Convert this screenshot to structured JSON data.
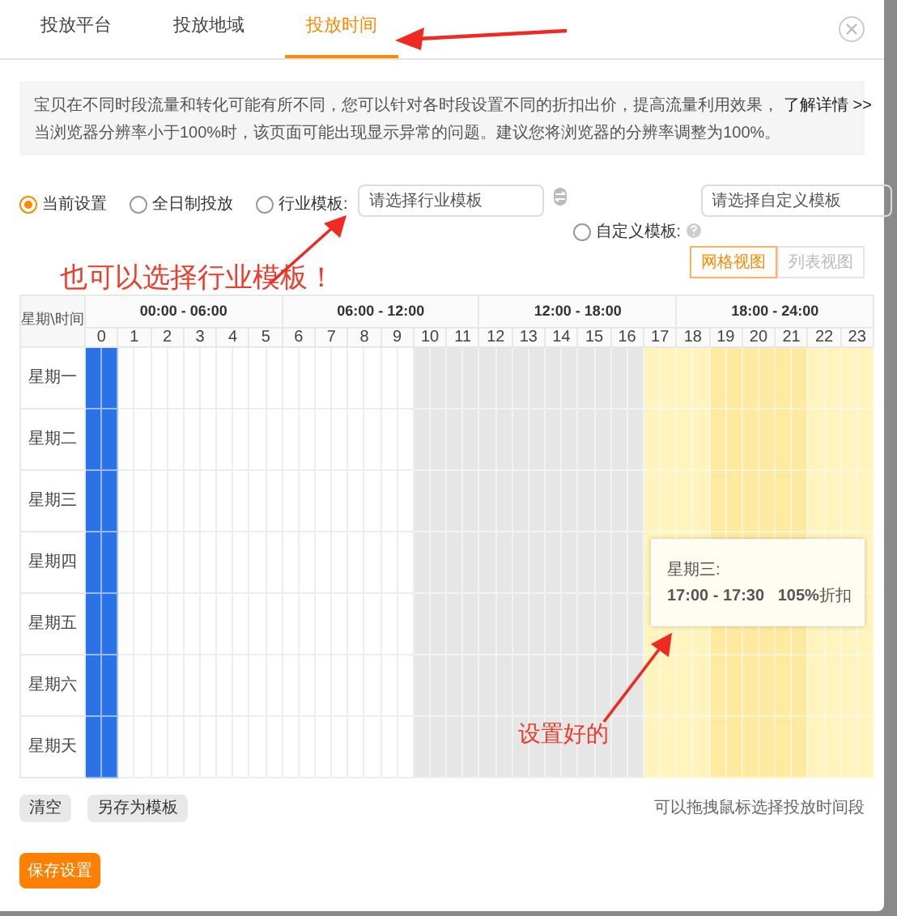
{
  "tabs": [
    {
      "label": "投放平台",
      "selected": false
    },
    {
      "label": "投放地域",
      "selected": false
    },
    {
      "label": "投放时间",
      "selected": true
    }
  ],
  "notice": {
    "lines": [
      "宝贝在不同时段流量和转化可能有所不同，您可以针对各时段设置不同的折扣出价，提高流量利用效果，",
      "当浏览器分辨率小于100%时，该页面可能出现显示异常的问题。建议您将浏览器的分辨率调整为100%。"
    ],
    "link": "了解详情 >>"
  },
  "template_options": [
    {
      "kind": "plain",
      "label": "当前设置",
      "selected": true
    },
    {
      "kind": "plain",
      "label": "全日制投放",
      "selected": false
    },
    {
      "kind": "industry",
      "label": "行业模板:",
      "selected": false,
      "placeholder": "请选择行业模板"
    },
    {
      "kind": "custom",
      "label": "自定义模板:",
      "selected": false,
      "placeholder": "请选择自定义模板"
    }
  ],
  "view_toggle": [
    {
      "label": "网格视图",
      "selected": true
    },
    {
      "label": "列表视图",
      "selected": false
    }
  ],
  "grid": {
    "corner": "星期\\时间",
    "groups": [
      "00:00 - 06:00",
      "06:00 - 12:00",
      "12:00 - 18:00",
      "18:00 - 24:00"
    ],
    "hours": [
      {
        "label": "0",
        "color": "#2b72e6"
      },
      {
        "label": "1",
        "color": "#ffffff"
      },
      {
        "label": "2",
        "color": "#ffffff"
      },
      {
        "label": "3",
        "color": "#ffffff"
      },
      {
        "label": "4",
        "color": "#ffffff"
      },
      {
        "label": "5",
        "color": "#ffffff"
      },
      {
        "label": "6",
        "color": "#ffffff"
      },
      {
        "label": "7",
        "color": "#ffffff"
      },
      {
        "label": "8",
        "color": "#ffffff"
      },
      {
        "label": "9",
        "color": "#ffffff"
      },
      {
        "label": "10",
        "color": "#e6e6e6"
      },
      {
        "label": "11",
        "color": "#e6e6e6"
      },
      {
        "label": "12",
        "color": "#e6e6e6"
      },
      {
        "label": "13",
        "color": "#e6e6e6"
      },
      {
        "label": "14",
        "color": "#e6e6e6"
      },
      {
        "label": "15",
        "color": "#e6e6e6"
      },
      {
        "label": "16",
        "color": "#e6e6e6"
      },
      {
        "label": "17",
        "color": "#fff4bd"
      },
      {
        "label": "18",
        "color": "#fff4bd"
      },
      {
        "label": "19",
        "color": "#ffea9f"
      },
      {
        "label": "20",
        "color": "#ffea9f"
      },
      {
        "label": "21",
        "color": "#ffea9f"
      },
      {
        "label": "22",
        "color": "#fff4bd"
      },
      {
        "label": "23",
        "color": "#fff4bd"
      }
    ],
    "days": [
      "星期一",
      "星期二",
      "星期三",
      "星期四",
      "星期五",
      "星期六",
      "星期天"
    ]
  },
  "tooltip": {
    "title": "星期三:",
    "text": "**17:00 - 17:30   105%**折扣"
  },
  "actions": [
    "清空",
    "另存为模板"
  ],
  "hint": "可以拖拽鼠标选择投放时间段",
  "save_button": "保存设置",
  "annotations": [
    {
      "text": "也可以选择行业模板！"
    },
    {
      "text": "设置好的"
    }
  ]
}
